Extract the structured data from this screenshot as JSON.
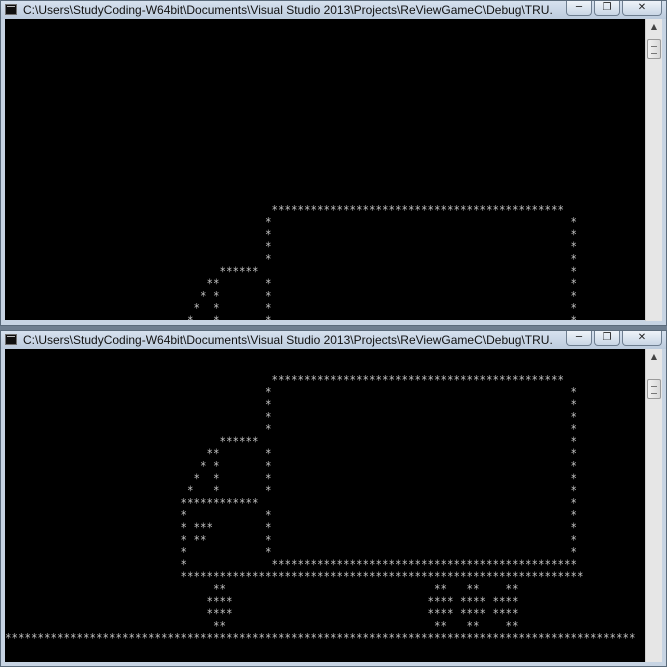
{
  "windows": [
    {
      "title": "C:\\Users\\StudyCoding-W64bit\\Documents\\Visual Studio 2013\\Projects\\ReViewGameC\\Debug\\TRU...",
      "controls": {
        "minimize_icon": "─",
        "restore_icon": "❐",
        "close_icon": "✕"
      },
      "console_text": "\n\n\n\n\n\n\n\n\n\n\n\n\n\n\n                                         *********************************************\n                                        *                                              *\n                                        *                                              *\n                                        *                                              *\n                                        *                                              *\n                                 ******                                                *\n                               **       *                                              *\n                              * *       *                                              *\n                             *  *       *                                              *\n                            *   *       *                                              *\n                           **\n"
    },
    {
      "title": "C:\\Users\\StudyCoding-W64bit\\Documents\\Visual Studio 2013\\Projects\\ReViewGameC\\Debug\\TRU...",
      "controls": {
        "minimize_icon": "─",
        "restore_icon": "❐",
        "close_icon": "✕"
      },
      "console_text": "\n\n                                         *********************************************\n                                        *                                              *\n                                        *                                              *\n                                        *                                              *\n                                        *                                              *\n                                 ******                                                *\n                               **       *                                              *\n                              * *       *                                              *\n                             *  *       *                                              *\n                            *   *       *                                              *\n                           ************                                                *\n                           *            *                                              *\n                           * ***        *                                              *\n                           * **         *                                              *\n                           *            *                                              *\n                           *             ***********************************************\n                           **************************************************************\n                                **                                **   **    **\n                               ****                              **** **** ****\n                               ****                              **** **** ****\n                                **                                **   **    **\n*************************************************************************************************"
    }
  ]
}
